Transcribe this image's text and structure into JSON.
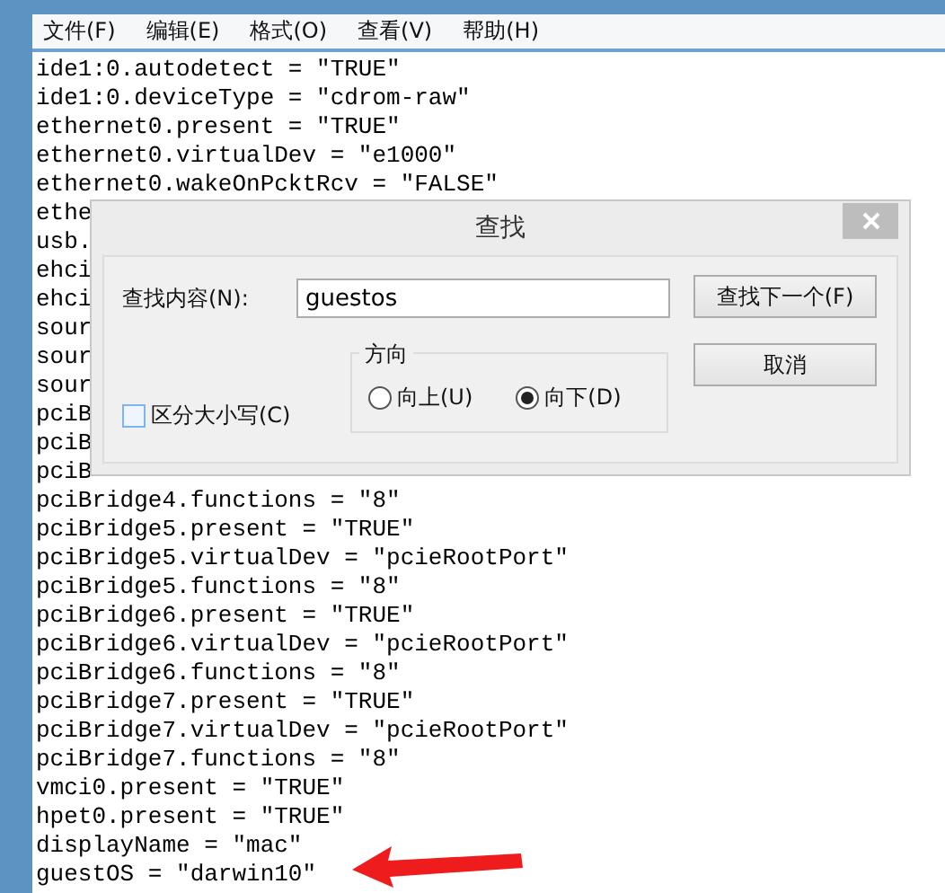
{
  "menu": [
    "文件(F)",
    "编辑(E)",
    "格式(O)",
    "查看(V)",
    "帮助(H)"
  ],
  "editor": {
    "lines": [
      "ide1:0.autodetect = \"TRUE\"",
      "ide1:0.deviceType = \"cdrom-raw\"",
      "ethernet0.present = \"TRUE\"",
      "ethernet0.virtualDev = \"e1000\"",
      "ethernet0.wakeOnPcktRcv = \"FALSE\"",
      "ethe",
      "usb.",
      "ehci",
      "ehci",
      "sour",
      "sour",
      "sour",
      "pciB",
      "pciB",
      "pciB",
      "pciBridge4.functions = \"8\"",
      "pciBridge5.present = \"TRUE\"",
      "pciBridge5.virtualDev = \"pcieRootPort\"",
      "pciBridge5.functions = \"8\"",
      "pciBridge6.present = \"TRUE\"",
      "pciBridge6.virtualDev = \"pcieRootPort\"",
      "pciBridge6.functions = \"8\"",
      "pciBridge7.present = \"TRUE\"",
      "pciBridge7.virtualDev = \"pcieRootPort\"",
      "pciBridge7.functions = \"8\"",
      "vmci0.present = \"TRUE\"",
      "hpet0.present = \"TRUE\"",
      "displayName = \"mac\"",
      "guestOS = \"darwin10\""
    ]
  },
  "find_dialog": {
    "title": "查找",
    "find_label": "查找内容(N):",
    "find_value": "guestos",
    "find_next_button": "查找下一个(F)",
    "cancel_button": "取消",
    "match_case": {
      "label": "区分大小写(C)",
      "checked": false
    },
    "direction": {
      "label": "方向",
      "options": [
        {
          "label": "向上(U)",
          "selected": false
        },
        {
          "label": "向下(D)",
          "selected": true
        }
      ]
    }
  }
}
